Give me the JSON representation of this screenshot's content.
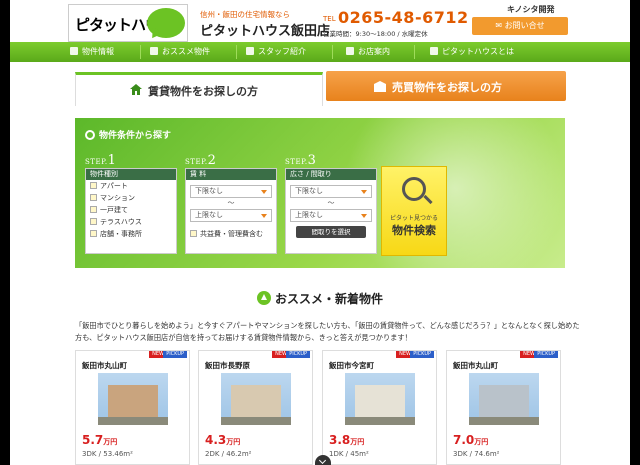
{
  "header": {
    "logo_text": "ピタットハウス",
    "catch": "信州・飯田の住宅情報なら",
    "shop_name": "ピタットハウス飯田店",
    "tel_label": "TEL",
    "tel": "0265-48-6712",
    "hours": "営業時間：9:30～18:00 / 水曜定休",
    "brand": "キノシタ開発",
    "contact_label": "お問い合せ"
  },
  "nav": {
    "items": [
      {
        "label": "物件情報",
        "icon": "house-icon"
      },
      {
        "label": "おススメ物件",
        "icon": "thumbs-up-icon"
      },
      {
        "label": "スタッフ紹介",
        "icon": "person-icon"
      },
      {
        "label": "お店案内",
        "icon": "shop-icon"
      },
      {
        "label": "ピタットハウスとは",
        "icon": "info-icon"
      }
    ]
  },
  "tabs": {
    "rent": "賃貸物件をお探しの方",
    "sale": "売買物件をお探しの方"
  },
  "search": {
    "title": "物件条件から探す",
    "step_word": "STEP.",
    "step1": {
      "num": "1",
      "header": "物件種別",
      "options": [
        "アパート",
        "マンション",
        "一戸建て",
        "テラスハウス",
        "店舗・事務所"
      ]
    },
    "step2": {
      "num": "2",
      "header": "賃 料",
      "min": "下限なし",
      "tilde": "～",
      "max": "上限なし",
      "option": "共益費・管理費含む"
    },
    "step3": {
      "num": "3",
      "header": "広さ / 間取り",
      "min": "下限なし",
      "tilde": "～",
      "max": "上限なし",
      "button": "間取りを選択"
    },
    "go_small": "ピタット見つかる",
    "go_big": "物件検索"
  },
  "featured": {
    "title": "おススメ・新着物件",
    "intro": "「飯田市でひとり暮らしを始めよう」と今すぐアパートやマンションを探したい方も、「飯田の賃貸物件って、どんな感じだろう？」となんとなく探し始めた方も、ピタットハウス飯田店が自信を持ってお届けする賃貸物件情報から、きっと答えが見つかります！",
    "new_label": "NEW",
    "pick_label": "PICKUP",
    "cards": [
      {
        "area": "飯田市丸山町",
        "price": "5.7",
        "unit": "万円",
        "spec": "3DK / 53.46m²"
      },
      {
        "area": "飯田市長野原",
        "price": "4.3",
        "unit": "万円",
        "spec": "2DK / 46.2m²"
      },
      {
        "area": "飯田市今宮町",
        "price": "3.8",
        "unit": "万円",
        "spec": "1DK / 45m²"
      },
      {
        "area": "飯田市丸山町",
        "price": "7.0",
        "unit": "万円",
        "spec": "3DK / 74.6m²"
      }
    ]
  },
  "colors": {
    "green": "#6cc324",
    "orange": "#e8821c",
    "price_red": "#d82020"
  }
}
